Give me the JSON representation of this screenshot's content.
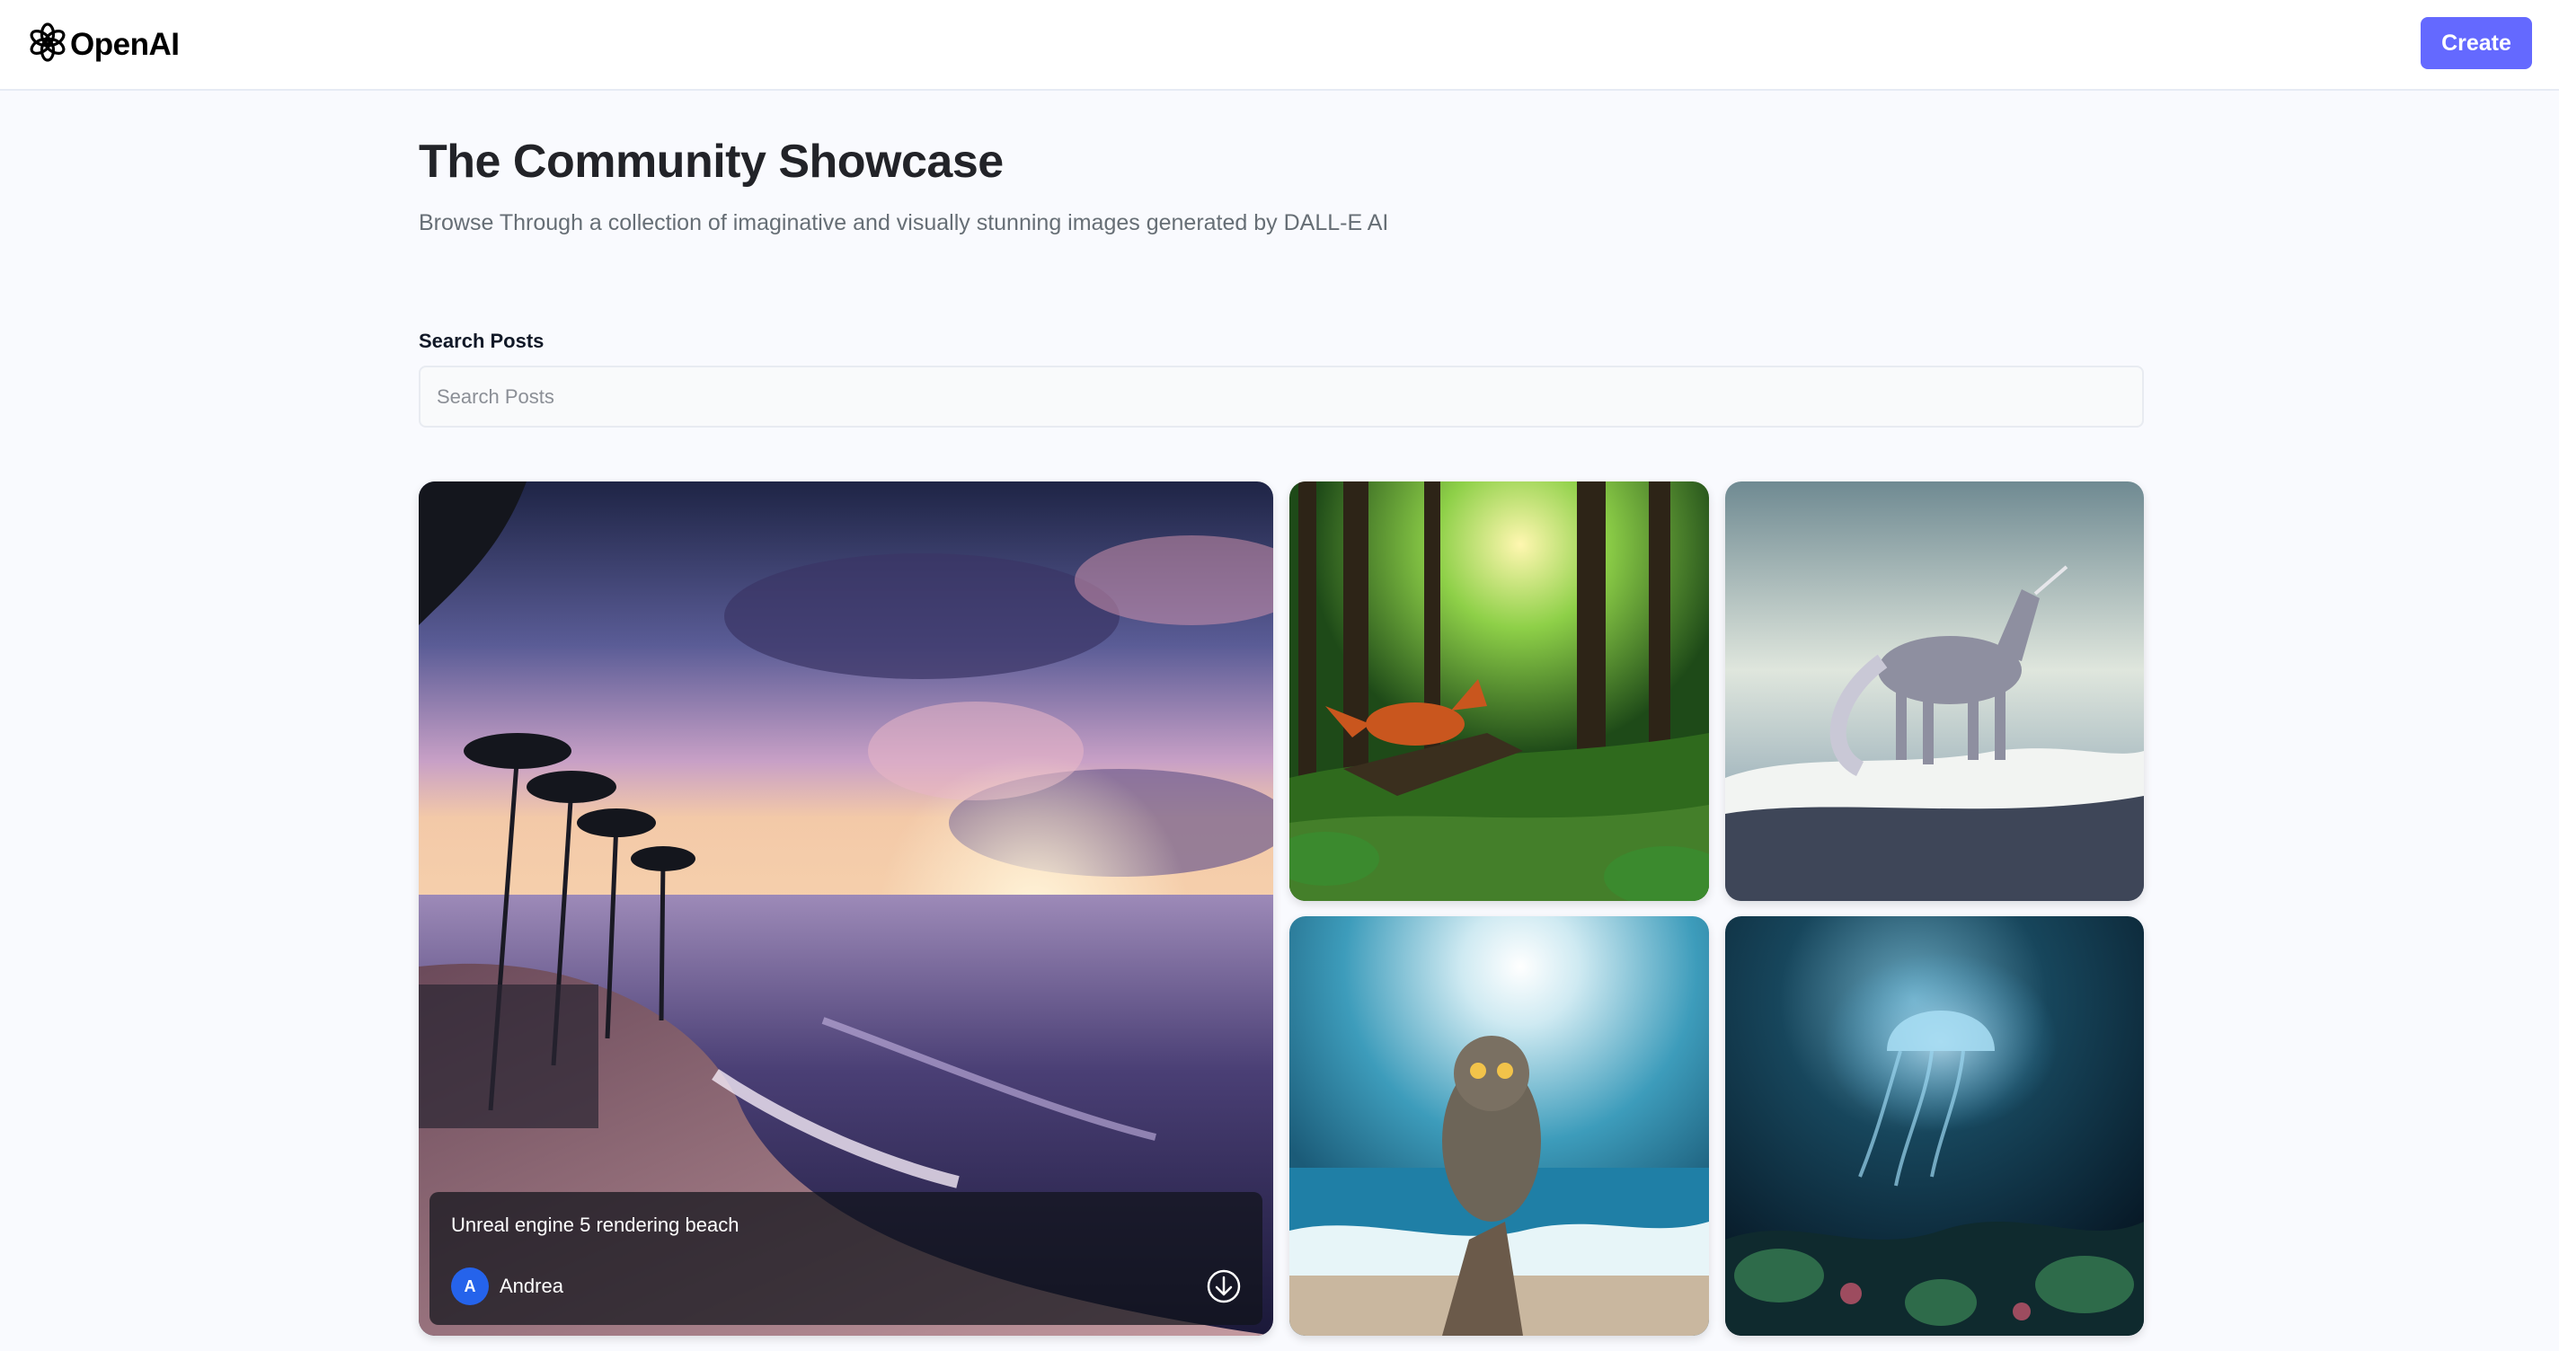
{
  "header": {
    "logo_text": "OpenAI",
    "logo_icon": "openai-logo-icon",
    "create_label": "Create"
  },
  "hero": {
    "title": "The Community Showcase",
    "subtitle": "Browse Through a collection of imaginative and visually stunning images generated by DALL-E AI"
  },
  "search": {
    "label": "Search Posts",
    "placeholder": "Search Posts",
    "value": ""
  },
  "posts": [
    {
      "image": "beach-sunset-image",
      "prompt": "Unreal engine 5 rendering beach",
      "author": "Andrea",
      "avatar_initial": "A",
      "download_icon": "download-icon"
    },
    {
      "image": "forest-fox-image"
    },
    {
      "image": "unicorn-waves-image"
    },
    {
      "image": "owl-ocean-image"
    },
    {
      "image": "jellyfish-underwater-image"
    }
  ],
  "colors": {
    "accent": "#6469ff",
    "background": "#f9fafe",
    "heading": "#222328",
    "subtext": "#666e75",
    "avatar": "#2563eb"
  }
}
